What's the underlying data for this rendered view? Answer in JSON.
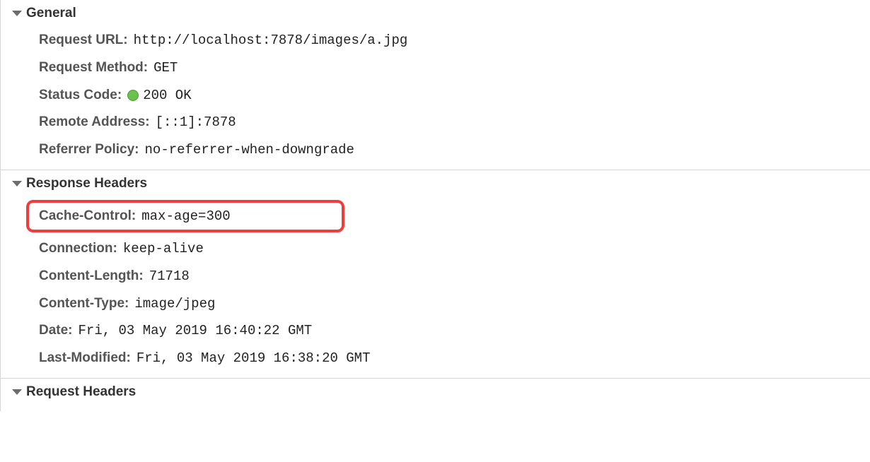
{
  "sections": {
    "general": {
      "title": "General",
      "rows": {
        "request_url": {
          "label": "Request URL:",
          "value": "http://localhost:7878/images/a.jpg"
        },
        "request_method": {
          "label": "Request Method:",
          "value": "GET"
        },
        "status_code": {
          "label": "Status Code:",
          "value": "200 OK"
        },
        "remote_address": {
          "label": "Remote Address:",
          "value": "[::1]:7878"
        },
        "referrer_policy": {
          "label": "Referrer Policy:",
          "value": "no-referrer-when-downgrade"
        }
      }
    },
    "response_headers": {
      "title": "Response Headers",
      "rows": {
        "cache_control": {
          "label": "Cache-Control:",
          "value": "max-age=300"
        },
        "connection": {
          "label": "Connection:",
          "value": "keep-alive"
        },
        "content_length": {
          "label": "Content-Length:",
          "value": "71718"
        },
        "content_type": {
          "label": "Content-Type:",
          "value": "image/jpeg"
        },
        "date": {
          "label": "Date:",
          "value": "Fri, 03 May 2019 16:40:22 GMT"
        },
        "last_modified": {
          "label": "Last-Modified:",
          "value": "Fri, 03 May 2019 16:38:20 GMT"
        }
      }
    },
    "request_headers": {
      "title": "Request Headers"
    }
  }
}
